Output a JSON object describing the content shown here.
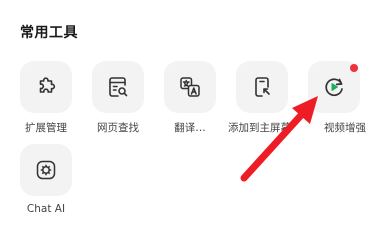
{
  "section": {
    "title": "常用工具"
  },
  "tools": [
    {
      "label": "扩展管理",
      "icon": "puzzle-icon"
    },
    {
      "label": "网页查找",
      "icon": "page-search-icon"
    },
    {
      "label": "翻译…",
      "icon": "translate-icon"
    },
    {
      "label": "添加到主屏幕",
      "icon": "add-to-home-icon"
    },
    {
      "label": "视频增强",
      "icon": "video-enhance-icon",
      "has_badge": true
    },
    {
      "label": "Chat AI",
      "icon": "chat-ai-icon"
    }
  ],
  "colors": {
    "tile_bg": "#f3f3f3",
    "badge": "#f0303c",
    "accent_green": "#19b05a",
    "annotation_arrow": "#ee1c24"
  }
}
